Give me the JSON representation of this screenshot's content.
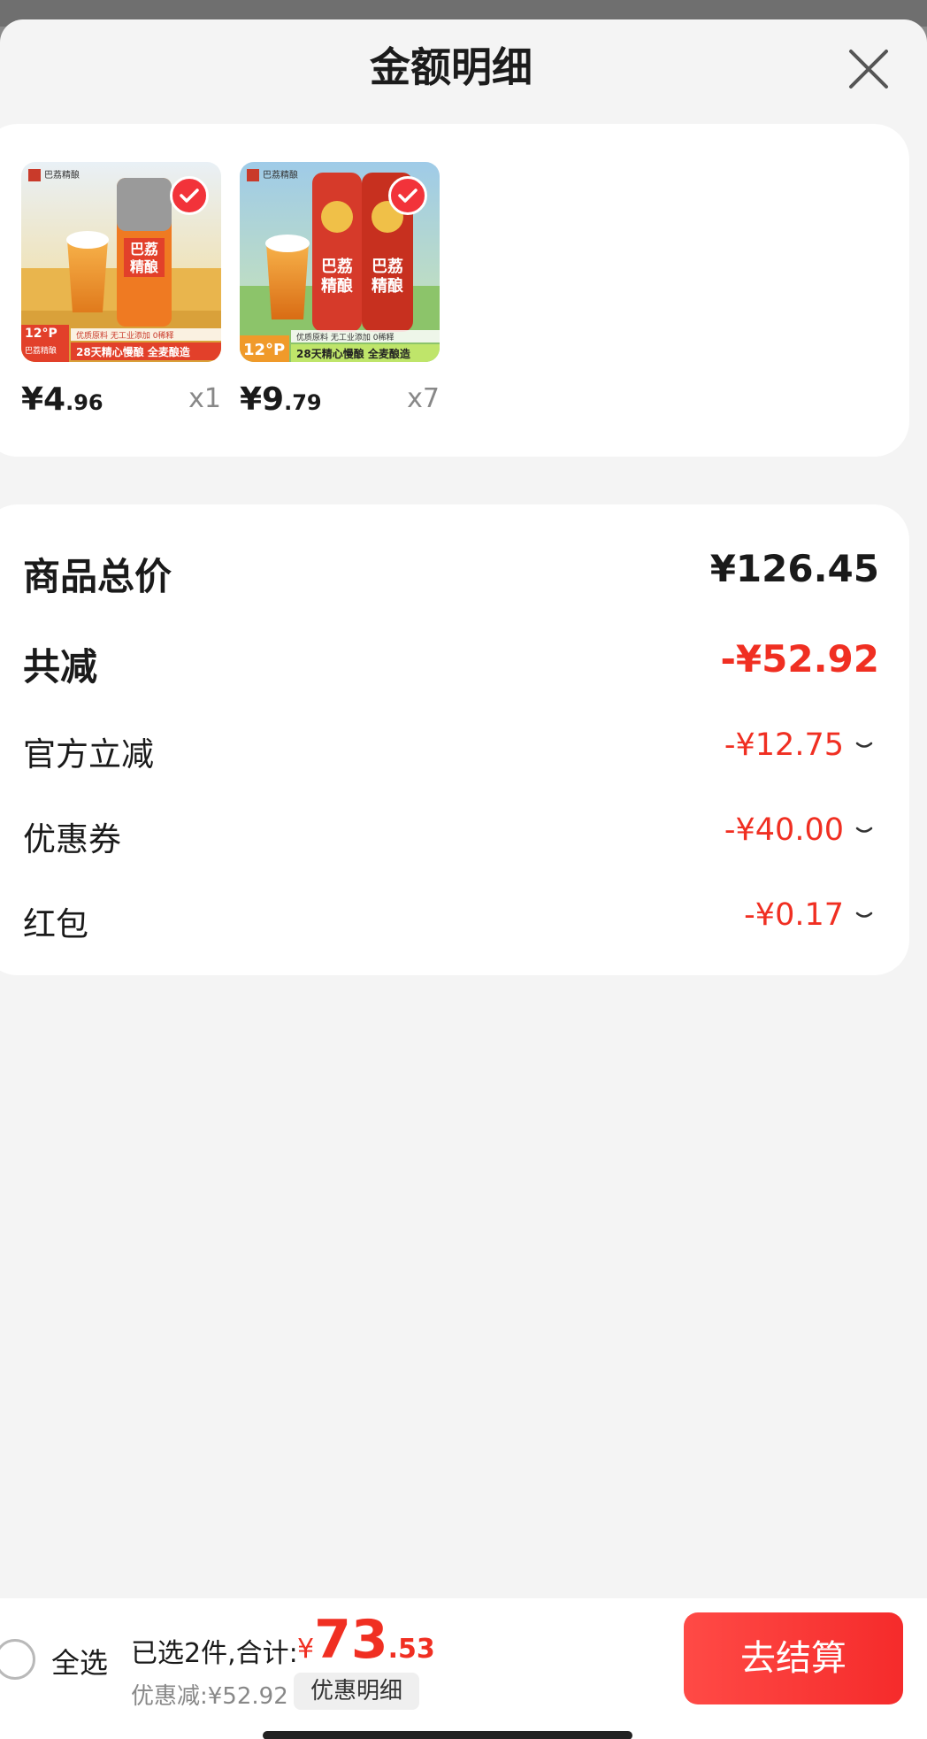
{
  "sheet": {
    "title": "金额明细"
  },
  "products": [
    {
      "price_int": "¥4",
      "price_dec": ".96",
      "qty": "x1",
      "selected": true,
      "thumb_text": {
        "brand": "巴荔精酿",
        "tag": "巴荔精酿",
        "footer": "28天精心慢酿 全麦酿造",
        "features": "优质原料 无工业添加 0稀释",
        "degree": "12°P"
      }
    },
    {
      "price_int": "¥9",
      "price_dec": ".79",
      "qty": "x7",
      "selected": true,
      "thumb_text": {
        "brand": "巴荔精酿",
        "tag": "巴荔精酿",
        "footer": "28天精心慢酿 全麦酿造",
        "features": "优质原料 无工业添加 0稀释",
        "degree": "12°P"
      }
    }
  ],
  "summary": {
    "total_label": "商品总价",
    "total_value": "¥126.45",
    "reduce_label": "共减",
    "reduce_value": "-¥52.92",
    "items": [
      {
        "label": "官方立减",
        "value": "-¥12.75"
      },
      {
        "label": "优惠券",
        "value": "-¥40.00"
      },
      {
        "label": "红包",
        "value": "-¥0.17"
      }
    ]
  },
  "bottom": {
    "select_all": "全选",
    "selected_text": "已选2件,合计:",
    "total_yen": "¥",
    "total_int": "73",
    "total_dec": ".53",
    "discount_text": "优惠减:¥52.92",
    "detail_button": "优惠明细",
    "checkout_button": "去结算"
  },
  "colors": {
    "accent": "#f02f22",
    "button": "#f52b2b",
    "sheet_bg": "#f4f4f4"
  }
}
